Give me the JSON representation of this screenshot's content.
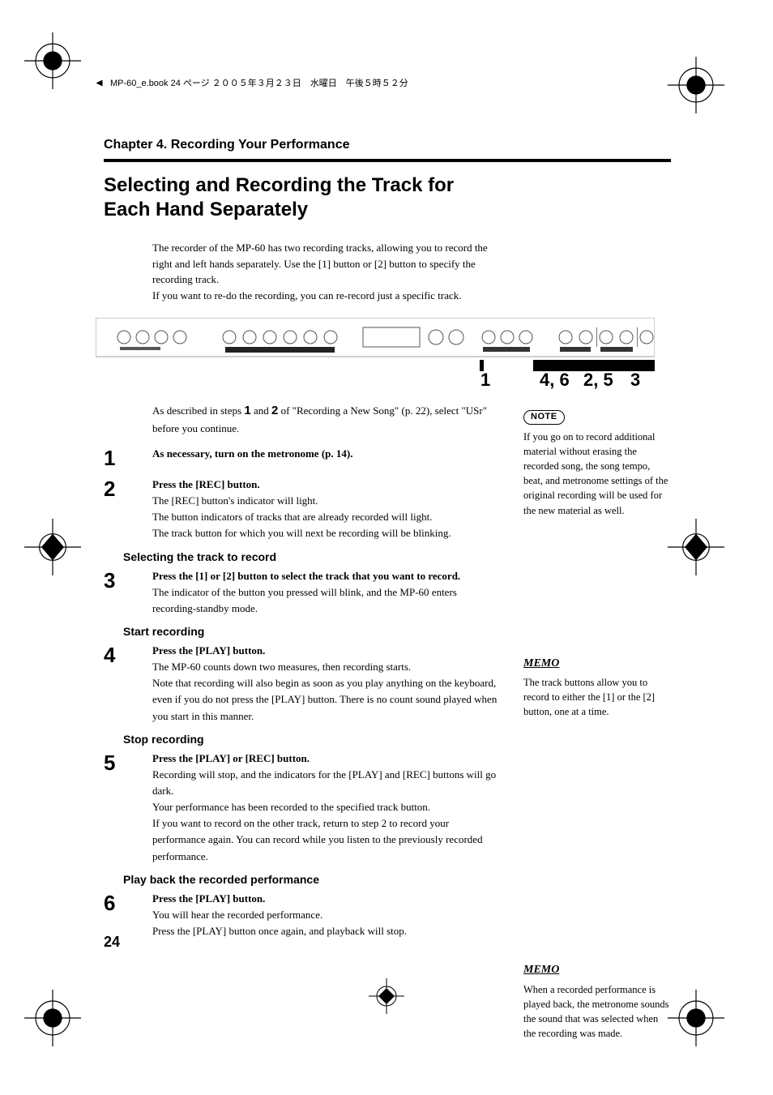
{
  "running_head": "MP-60_e.book 24 ページ ２００５年３月２３日　水曜日　午後５時５２分",
  "chapter": "Chapter 4. Recording Your Performance",
  "title": "Selecting and Recording the Track for Each Hand Separately",
  "intro": {
    "p1": "The recorder of the MP-60 has two recording tracks, allowing you to record the right and left hands separately. Use the [1] button or [2] button to specify the recording track.",
    "p2": "If you want to re-do the recording, you can re-record just a specific track."
  },
  "panel_callouts": {
    "a": "1",
    "b": "4, 6",
    "c": "2, 5",
    "d": "3"
  },
  "continue": {
    "pre": "As described in steps ",
    "b1": "1",
    "mid": " and ",
    "b2": "2",
    "post": " of \"Recording a New Song\" (p. 22), select \"USr\" before you continue."
  },
  "steps": {
    "s1": {
      "num": "1",
      "lead": "As necessary, turn on the metronome (p. 14)."
    },
    "s2": {
      "num": "2",
      "lead": "Press the [REC] button.",
      "l1": "The [REC] button's indicator will light.",
      "l2": "The button indicators of tracks that are already recorded will light.",
      "l3": "The track button for which you will next be recording will be blinking."
    },
    "h_select": "Selecting the track to record",
    "s3": {
      "num": "3",
      "lead": "Press the [1] or [2] button to select the track that you want to record.",
      "l1": "The indicator of the button you pressed will blink, and the MP-60 enters recording-standby mode."
    },
    "h_start": "Start recording",
    "s4": {
      "num": "4",
      "lead": "Press the [PLAY] button.",
      "l1": "The MP-60 counts down two measures, then recording starts.",
      "l2": "Note that recording will also begin as soon as you play anything on the keyboard, even if you do not press the [PLAY] button. There is no count sound played when you start in this manner."
    },
    "h_stop": "Stop recording",
    "s5": {
      "num": "5",
      "lead": "Press the [PLAY] or [REC] button.",
      "l1": "Recording will stop, and the indicators for the [PLAY] and [REC] buttons will go dark.",
      "l2": "Your performance has been recorded to the specified track button.",
      "l3": "If you want to record on the other track, return to step 2 to record your performance again. You can record while you listen to the previously recorded performance."
    },
    "h_play": "Play back the recorded performance",
    "s6": {
      "num": "6",
      "lead": "Press the [PLAY] button.",
      "l1": "You will hear the recorded performance.",
      "l2": "Press the [PLAY] button once again, and playback will stop."
    }
  },
  "side": {
    "note_label": "NOTE",
    "note_text": "If you go on to record additional material without erasing the recorded song, the song tempo, beat, and metronome settings of the original recording will be used for the new material as well.",
    "memo_label": "MEMO",
    "memo1_text": "The track buttons allow you to record to either the [1] or the [2] button, one at a time.",
    "memo2_text": "When a recorded performance is played back, the metronome sounds the sound that was selected when the recording was made."
  },
  "page_number": "24"
}
